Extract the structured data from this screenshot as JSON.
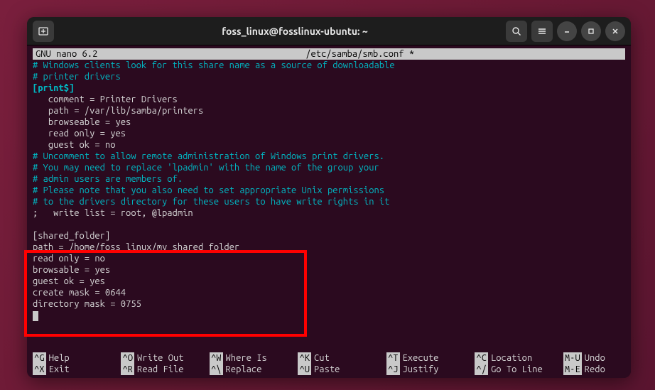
{
  "titlebar": {
    "title": "foss_linux@fosslinux-ubuntu: ~"
  },
  "nano": {
    "app": "  GNU nano 6.2",
    "file": "/etc/samba/smb.conf *"
  },
  "content": {
    "l1": "# Windows clients look for this share name as a source of downloadable",
    "l2": "# printer drivers",
    "l3": "[print$]",
    "l4": "   comment = Printer Drivers",
    "l5": "   path = /var/lib/samba/printers",
    "l6": "   browseable = yes",
    "l7": "   read only = yes",
    "l8": "   guest ok = no",
    "l9": "# Uncomment to allow remote administration of Windows print drivers.",
    "l10": "# You may need to replace 'lpadmin' with the name of the group your",
    "l11": "# admin users are members of.",
    "l12": "# Please note that you also need to set appropriate Unix permissions",
    "l13": "# to the drivers directory for these users to have write rights in it",
    "l14": ";   write list = root, @lpadmin",
    "l15": " ",
    "l16": "[shared_folder]",
    "l17": "path = /home/foss_linux/my_shared_folder",
    "l18": "read only = no",
    "l19": "browsable = yes",
    "l20": "guest ok = yes",
    "l21": "create mask = 0644",
    "l22": "directory mask = 0755"
  },
  "footer": {
    "r1c1k": "^G",
    "r1c1": "Help",
    "r1c2k": "^O",
    "r1c2": "Write Out",
    "r1c3k": "^W",
    "r1c3": "Where Is",
    "r1c4k": "^K",
    "r1c4": "Cut",
    "r1c5k": "^T",
    "r1c5": "Execute",
    "r1c6k": "^C",
    "r1c6": "Location",
    "r1c7k": "M-U",
    "r1c7": "Undo",
    "r2c1k": "^X",
    "r2c1": "Exit",
    "r2c2k": "^R",
    "r2c2": "Read File",
    "r2c3k": "^\\",
    "r2c3": "Replace",
    "r2c4k": "^U",
    "r2c4": "Paste",
    "r2c5k": "^J",
    "r2c5": "Justify",
    "r2c6k": "^/",
    "r2c6": "Go To Line",
    "r2c7k": "M-E",
    "r2c7": "Redo"
  }
}
